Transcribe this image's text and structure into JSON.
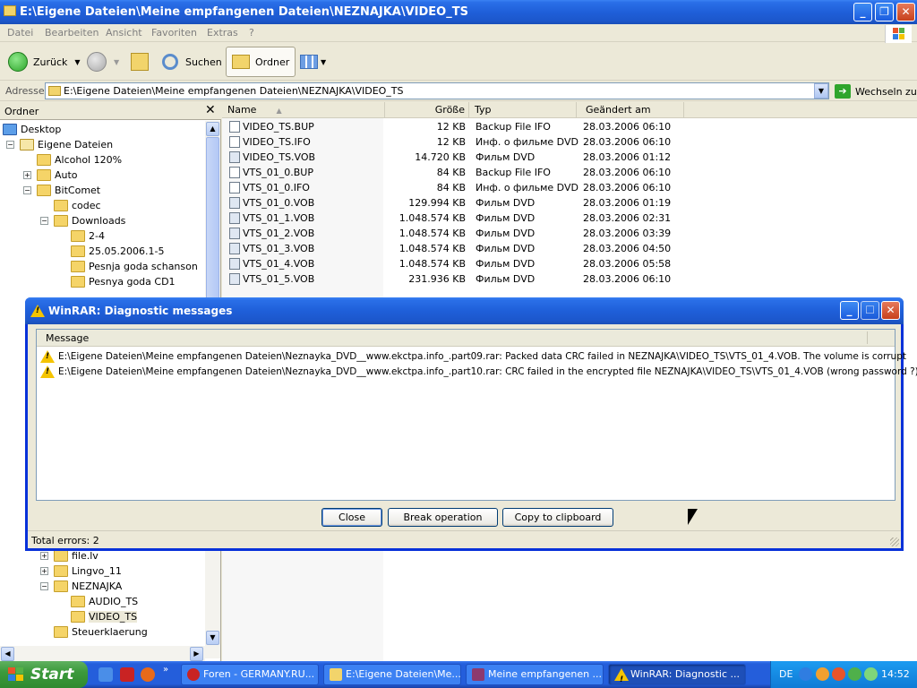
{
  "explorer": {
    "title": "E:\\Eigene Dateien\\Meine empfangenen Dateien\\NEZNAJKA\\VIDEO_TS",
    "menu": [
      "Datei",
      "Bearbeiten",
      "Ansicht",
      "Favoriten",
      "Extras",
      "?"
    ],
    "toolbar": {
      "back": "Zurück",
      "search": "Suchen",
      "folders": "Ordner"
    },
    "address": {
      "label": "Adresse",
      "value": "E:\\Eigene Dateien\\Meine empfangenen Dateien\\NEZNAJKA\\VIDEO_TS",
      "go": "Wechseln zu"
    },
    "folder_pane": {
      "title": "Ordner",
      "items": [
        {
          "label": "Desktop",
          "icon": "desktop-icon"
        },
        {
          "label": "Eigene Dateien",
          "icon": "documents-icon"
        },
        {
          "label": "Alcohol 120%",
          "icon": "folder-icon"
        },
        {
          "label": "Auto",
          "icon": "folder-icon"
        },
        {
          "label": "BitComet",
          "icon": "folder-icon"
        },
        {
          "label": "codec",
          "icon": "folder-icon"
        },
        {
          "label": "Downloads",
          "icon": "folder-icon"
        },
        {
          "label": "2-4",
          "icon": "folder-icon"
        },
        {
          "label": "25.05.2006.1-5",
          "icon": "folder-icon"
        },
        {
          "label": "Pesnja goda schanson",
          "icon": "folder-icon"
        },
        {
          "label": "Pesnya goda CD1",
          "icon": "folder-icon"
        },
        {
          "label": "file.lv",
          "icon": "folder-icon"
        },
        {
          "label": "Lingvo_11",
          "icon": "folder-icon"
        },
        {
          "label": "NEZNAJKA",
          "icon": "folder-icon"
        },
        {
          "label": "AUDIO_TS",
          "icon": "folder-icon"
        },
        {
          "label": "VIDEO_TS",
          "icon": "folder-icon"
        },
        {
          "label": "Steuerklaerung",
          "icon": "folder-icon"
        }
      ]
    },
    "file_list": {
      "columns": [
        "Name",
        "Größe",
        "Typ",
        "Geändert am"
      ],
      "rows": [
        {
          "name": "VIDEO_TS.BUP",
          "size": "12 KB",
          "type": "Backup File IFO",
          "date": "28.03.2006 06:10"
        },
        {
          "name": "VIDEO_TS.IFO",
          "size": "12 KB",
          "type": "Инф. о фильме DVD",
          "date": "28.03.2006 06:10"
        },
        {
          "name": "VIDEO_TS.VOB",
          "size": "14.720 KB",
          "type": "Фильм DVD",
          "date": "28.03.2006 01:12"
        },
        {
          "name": "VTS_01_0.BUP",
          "size": "84 KB",
          "type": "Backup File IFO",
          "date": "28.03.2006 06:10"
        },
        {
          "name": "VTS_01_0.IFO",
          "size": "84 KB",
          "type": "Инф. о фильме DVD",
          "date": "28.03.2006 06:10"
        },
        {
          "name": "VTS_01_0.VOB",
          "size": "129.994 KB",
          "type": "Фильм DVD",
          "date": "28.03.2006 01:19"
        },
        {
          "name": "VTS_01_1.VOB",
          "size": "1.048.574 KB",
          "type": "Фильм DVD",
          "date": "28.03.2006 02:31"
        },
        {
          "name": "VTS_01_2.VOB",
          "size": "1.048.574 KB",
          "type": "Фильм DVD",
          "date": "28.03.2006 03:39"
        },
        {
          "name": "VTS_01_3.VOB",
          "size": "1.048.574 KB",
          "type": "Фильм DVD",
          "date": "28.03.2006 04:50"
        },
        {
          "name": "VTS_01_4.VOB",
          "size": "1.048.574 KB",
          "type": "Фильм DVD",
          "date": "28.03.2006 05:58"
        },
        {
          "name": "VTS_01_5.VOB",
          "size": "231.936 KB",
          "type": "Фильм DVD",
          "date": "28.03.2006 06:10"
        }
      ]
    }
  },
  "dialog": {
    "title": "WinRAR: Diagnostic messages",
    "column": "Message",
    "messages": [
      "E:\\Eigene Dateien\\Meine empfangenen Dateien\\Neznayka_DVD__www.ekctpa.info_.part09.rar: Packed data CRC failed in NEZNAJKA\\VIDEO_TS\\VTS_01_4.VOB. The volume is corrupt",
      "E:\\Eigene Dateien\\Meine empfangenen Dateien\\Neznayka_DVD__www.ekctpa.info_.part10.rar: CRC failed in the encrypted file NEZNAJKA\\VIDEO_TS\\VTS_01_4.VOB (wrong password ?)"
    ],
    "buttons": {
      "close": "Close",
      "break": "Break operation",
      "copy": "Copy to clipboard"
    },
    "status": "Total errors: 2"
  },
  "taskbar": {
    "start": "Start",
    "tasks": [
      {
        "label": "Foren - GERMANY.RU..."
      },
      {
        "label": "E:\\Eigene Dateien\\Me..."
      },
      {
        "label": "Meine empfangenen ..."
      },
      {
        "label": "WinRAR: Diagnostic ..."
      }
    ],
    "language": "DE",
    "clock": "14:52"
  },
  "colors": {
    "xp_blue": "#245edb",
    "start_green": "#3c9a3c",
    "warning_yellow": "#f5c400"
  }
}
